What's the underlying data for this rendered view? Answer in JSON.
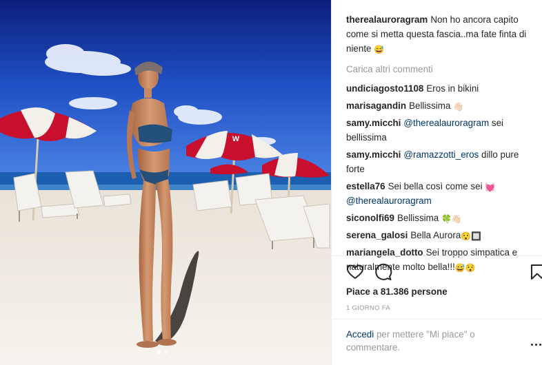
{
  "photo": {
    "umbrella_brand": "W"
  },
  "caption": {
    "user": "therealauroragram",
    "text": "Non ho ancora capito come si metta questa fascia..ma fate finta di niente",
    "emoji": "😅"
  },
  "load_more_label": "Carica altri commenti",
  "comments": [
    {
      "user": "undiciagosto1108",
      "text": "Eros in bikini"
    },
    {
      "user": "marisagandin",
      "text": "Bellissima",
      "emoji": "👋🏻"
    },
    {
      "user": "samy.micchi",
      "mention": "@therealauroragram",
      "text": "sei bellissima"
    },
    {
      "user": "samy.micchi",
      "mention": "@ramazzotti_eros",
      "text": "dillo pure forte"
    },
    {
      "user": "estella76",
      "text": "Sei bella così come sei",
      "emoji": "💓",
      "mention_after": "@therealauroragram"
    },
    {
      "user": "siconolfi69",
      "text": "Bellissima",
      "emoji": "🍀👋🏻"
    },
    {
      "user": "serena_galosi",
      "text": "Bella Aurora",
      "emoji": "😯🔲"
    },
    {
      "user": "mariangela_dotto",
      "text": "Sei troppo simpatica e naturalmente molto bella!!!",
      "emoji": "😅😯"
    }
  ],
  "actions": {
    "like_icon": "heart-outline-icon",
    "comment_icon": "speech-bubble-icon",
    "save_icon": "bookmark-outline-icon"
  },
  "likes_text": "Piace a 81.386 persone",
  "timestamp": "1 GIORNO FA",
  "comment_prompt": {
    "link": "Accedi",
    "text": "per mettere \"Mi piace\" o commentare."
  },
  "colors": {
    "text": "#262626",
    "muted": "#999999",
    "link": "#003569",
    "sky": "#1a3fa8",
    "sand": "#f1ece6",
    "umbrella_red": "#c8102e"
  }
}
